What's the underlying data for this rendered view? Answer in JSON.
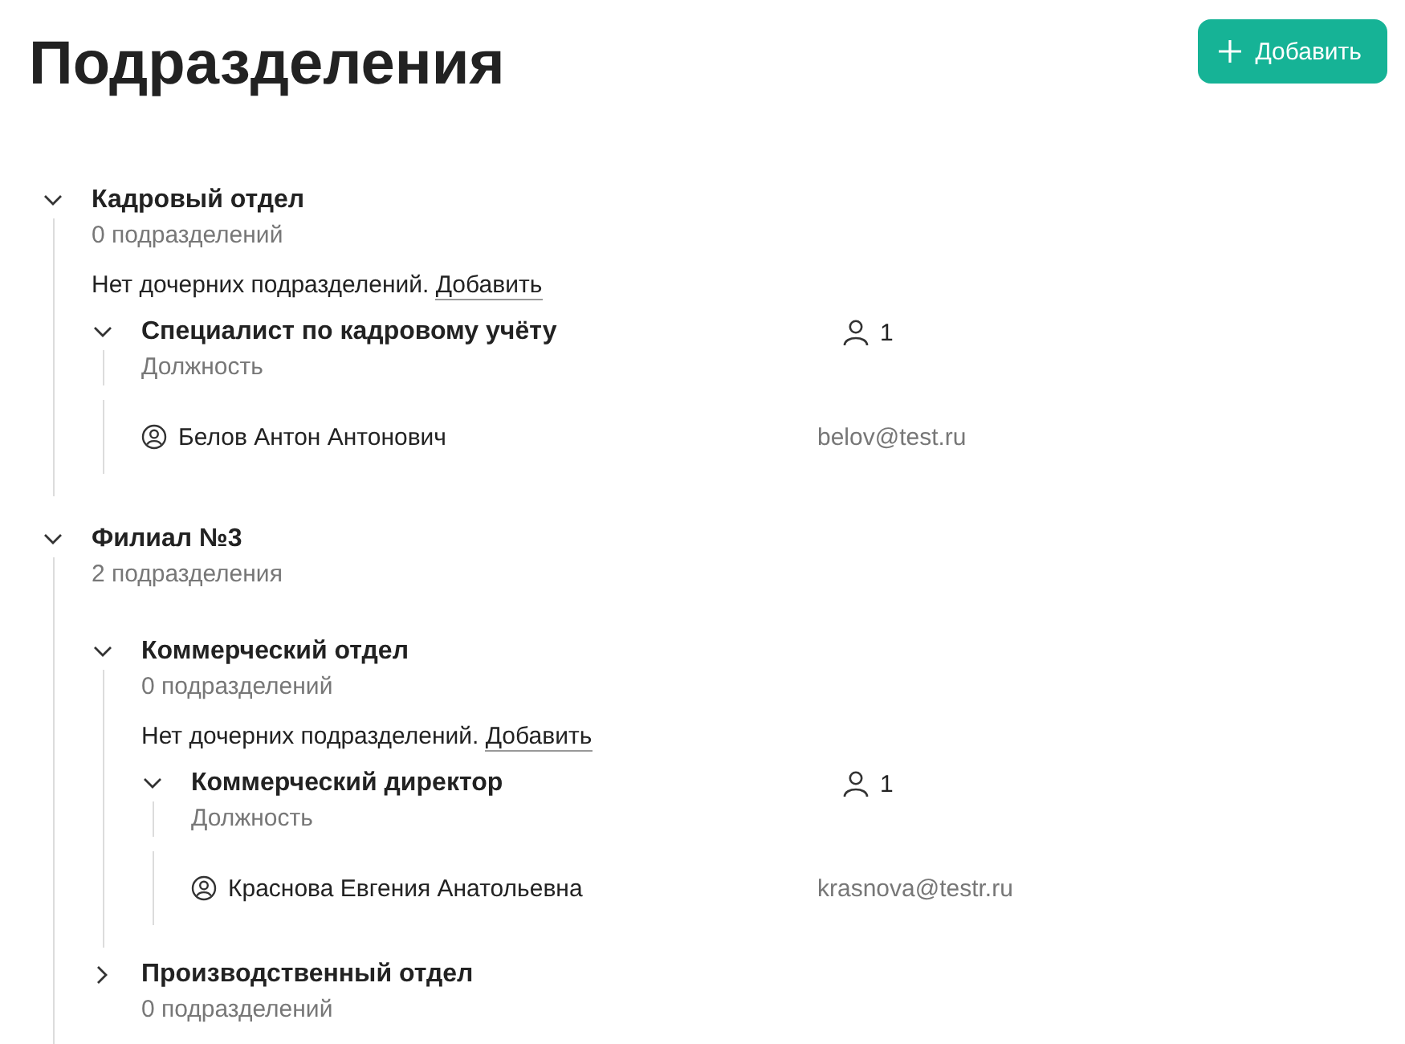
{
  "page": {
    "title": "Подразделения",
    "add_button": "Добавить"
  },
  "departments": [
    {
      "name": "Кадровый отдел",
      "expanded": true,
      "count": "0 подразделений",
      "empty_note": {
        "text": "Нет дочерних подразделений.",
        "link": "Добавить"
      },
      "positions": [
        {
          "name": "Специалист по кадровому учёту",
          "expanded": true,
          "label": "Должность",
          "headcount": "1",
          "employees": [
            {
              "name": "Белов Антон Антонович",
              "email": "belov@test.ru"
            }
          ]
        }
      ]
    },
    {
      "name": "Филиал №3",
      "expanded": true,
      "count": "2 подразделения",
      "children": [
        {
          "name": "Коммерческий отдел",
          "expanded": true,
          "count": "0 подразделений",
          "empty_note": {
            "text": "Нет дочерних подразделений.",
            "link": "Добавить"
          },
          "positions": [
            {
              "name": "Коммерческий директор",
              "expanded": true,
              "label": "Должность",
              "headcount": "1",
              "employees": [
                {
                  "name": "Краснова Евгения Анатольевна",
                  "email": "krasnova@testr.ru"
                }
              ]
            }
          ]
        },
        {
          "name": "Производственный отдел",
          "expanded": false,
          "count": "0 подразделений"
        }
      ]
    }
  ]
}
